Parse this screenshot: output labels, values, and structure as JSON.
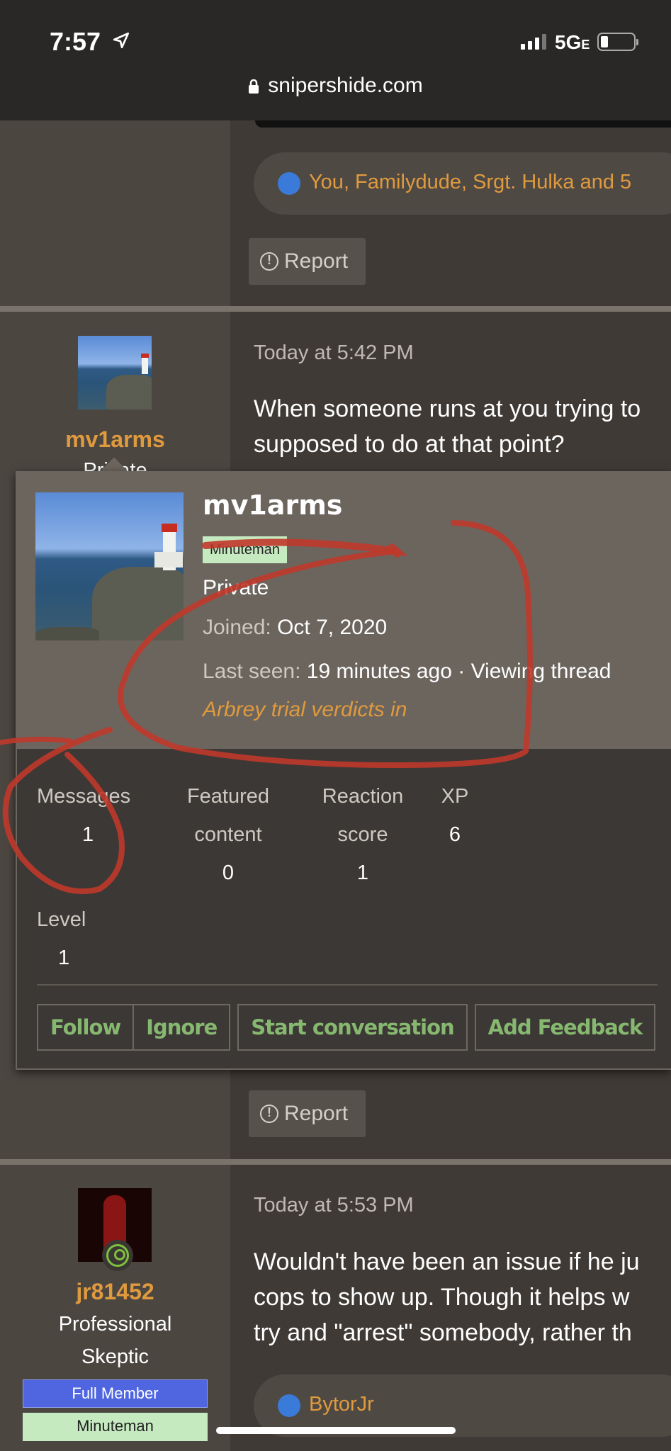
{
  "status_bar": {
    "time": "7:57",
    "network": "5G",
    "network_suffix": "E"
  },
  "browser": {
    "url": "snipershide.com"
  },
  "top_post": {
    "reactions_text": "You, Familydude, Srgt. Hulka and 5",
    "report_label": "Report"
  },
  "post_mv1arms": {
    "username": "mv1arms",
    "title_partial": "Private",
    "date": "Today at 5:42 PM",
    "text_line1": "When someone runs at you trying to",
    "text_line2": "supposed to do at that point?",
    "report_label": "Report"
  },
  "popup": {
    "username": "mv1arms",
    "badge": "Minuteman",
    "rank": "Private",
    "joined_label": "Joined:",
    "joined_value": "Oct 7, 2020",
    "last_seen_label": "Last seen:",
    "last_seen_value": "19 minutes ago · Viewing thread",
    "thread_title": "Arbrey trial verdicts in",
    "stats": {
      "messages_label": "Messages",
      "messages_value": "1",
      "featured_label_1": "Featured",
      "featured_label_2": "content",
      "featured_value": "0",
      "reaction_label_1": "Reaction",
      "reaction_label_2": "score",
      "reaction_value": "1",
      "xp_label": "XP",
      "xp_value": "6",
      "level_label": "Level",
      "level_value": "1"
    },
    "buttons": {
      "follow": "Follow",
      "ignore": "Ignore",
      "start_conversation": "Start conversation",
      "add_feedback": "Add Feedback"
    }
  },
  "post_jr81452": {
    "username": "jr81452",
    "title_line1": "Professional",
    "title_line2": "Skeptic",
    "banner_full_member": "Full Member",
    "banner_minuteman": "Minuteman",
    "date": "Today at 5:53 PM",
    "text_line1": "Wouldn't have been an issue if he ju",
    "text_line2": "cops to show up. Though it helps w",
    "text_line3": "try and \"arrest\" somebody, rather th",
    "reactions_text": "BytorJr"
  },
  "colors": {
    "accent_orange": "#e09a3e",
    "button_green": "#86b870",
    "badge_green": "#c6eac0",
    "full_member_blue": "#4f66e0",
    "annotation_red": "#c0392b"
  }
}
